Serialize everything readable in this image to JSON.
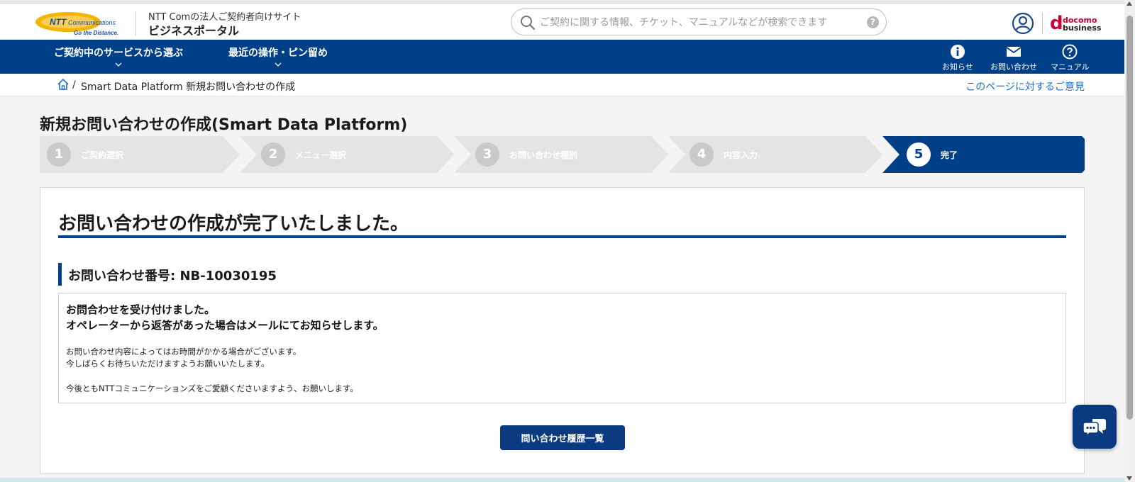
{
  "header": {
    "logo_brand": "NTT Communications",
    "logo_tagline": "Go the Distance.",
    "site_subtitle": "NTT Comの法人ご契約者向けサイト",
    "site_title": "ビジネスポータル",
    "search_placeholder": "ご契約に関する情報、チケット、マニュアルなどが検索できます",
    "docomo_line1": "docomo",
    "docomo_line2": "business"
  },
  "nav": {
    "left": [
      {
        "label": "ご契約中のサービスから選ぶ"
      },
      {
        "label": "最近の操作・ピン留め"
      }
    ],
    "right": [
      {
        "label": "お知らせ",
        "icon": "info-icon"
      },
      {
        "label": "お問い合わせ",
        "icon": "mail-icon"
      },
      {
        "label": "マニュアル",
        "icon": "help-icon"
      }
    ]
  },
  "breadcrumb": {
    "separator": "/",
    "current": "Smart Data Platform 新規お問い合わせの作成",
    "feedback_link": "このページに対するご意見"
  },
  "page": {
    "title": "新規お問い合わせの作成(Smart Data Platform)"
  },
  "steps": [
    {
      "num": "1",
      "label": "ご契約選択",
      "state": "inactive"
    },
    {
      "num": "2",
      "label": "メニュー選択",
      "state": "inactive"
    },
    {
      "num": "3",
      "label": "お問い合わせ種別",
      "state": "inactive"
    },
    {
      "num": "4",
      "label": "内容入力",
      "state": "inactive"
    },
    {
      "num": "5",
      "label": "完了",
      "state": "active"
    }
  ],
  "result": {
    "heading": "お問い合わせの作成が完了いたしました。",
    "inquiry_number_label": "お問い合わせ番号: NB-10030195",
    "message_line1": "お問合わせを受け付けました。",
    "message_line2": "オペレーターから返答があった場合はメールにてお知らせします。",
    "note_line1": "お問い合わせ内容によってはお時間がかかる場合がございます。",
    "note_line2": "今しばらくお待ちいただけますようお願いいたします。",
    "note_line3": "今後ともNTTコミュニケーションズをご愛顧くださいますよう、お願いします。",
    "history_button": "問い合わせ履歴一覧"
  },
  "colors": {
    "brand_blue": "#004088",
    "step_inactive": "#e4e4e4",
    "link_blue": "#1f6fc1",
    "docomo_red": "#cc0033"
  }
}
